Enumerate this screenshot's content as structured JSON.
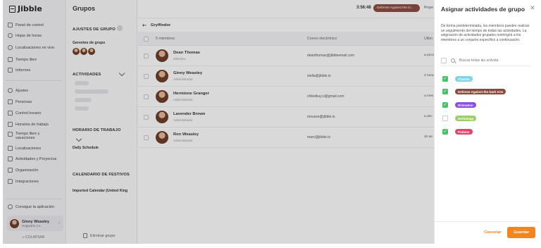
{
  "app": {
    "brand": "Jibble"
  },
  "sidebar": {
    "items": [
      {
        "label": "Panel de control",
        "icon": "dashboard-icon"
      },
      {
        "label": "Hojas de horas",
        "icon": "clock-icon"
      },
      {
        "label": "Localizaciones en vivo",
        "icon": "location-icon"
      },
      {
        "label": "Tiempo libre",
        "icon": "calendar-icon"
      },
      {
        "label": "Informes",
        "icon": "chart-icon"
      },
      {
        "label": "Ajustes",
        "icon": "settings-icon"
      },
      {
        "label": "Personas",
        "icon": "people-icon"
      },
      {
        "label": "Control horario",
        "icon": "timer-icon"
      },
      {
        "label": "Horarios de trabajo",
        "icon": "schedule-icon"
      },
      {
        "label": "Tiempo libre y vacaciones",
        "icon": "vacation-icon"
      },
      {
        "label": "Localizaciones",
        "icon": "pin-icon"
      },
      {
        "label": "Actividades y Proyectos",
        "icon": "projects-icon"
      },
      {
        "label": "Organización",
        "icon": "organization-icon"
      },
      {
        "label": "Integraciones",
        "icon": "integrations-icon"
      }
    ],
    "get_app": "Consigue la aplicación",
    "user": {
      "name": "Ginny Weasley",
      "org": "Hogwarts Co."
    },
    "collapse": "« COLAPSAR"
  },
  "group": {
    "page_title": "Grupos",
    "settings_title": "AJUSTES DE GRUPO",
    "managers_label": "Gerentes de grupo",
    "activities_title": "ACTIVIDADES",
    "schedule_title": "HORARIO DE TRABAJO",
    "schedule_value": "Daily Schedule",
    "holidays_title": "CALENDARIO DE FESTIVOS",
    "holidays_value": "Imported Calendar (United King",
    "delete": "Eliminar grupo"
  },
  "topbar": {
    "timer": "3:56:48",
    "current_activity": "Defense Against the D...",
    "project_clip": "Proye"
  },
  "members": {
    "back_label": "Gryffindor",
    "columns": [
      "5 miembros",
      "Correo electrónico",
      "Ultim"
    ],
    "rows": [
      {
        "name": "Dean Thomas",
        "role": "Miembro",
        "email": "deanthomas@jibbleemail.com",
        "last": "a pocos"
      },
      {
        "name": "Ginny Weasley",
        "role": "Administrador",
        "email": "stella@jibble.io",
        "last": "4 horas"
      },
      {
        "name": "Hermione Granger",
        "role": "Administrador",
        "email": "chiketkuy.o@gmail.com",
        "last": "a mes"
      },
      {
        "name": "Lavender Brown",
        "role": "Administrador",
        "email": "mousse@jibble.io",
        "last": "a dec"
      },
      {
        "name": "Ron Weasley",
        "role": "Administrador",
        "email": "marc@jibble.io",
        "last": "10 de"
      }
    ]
  },
  "drawer": {
    "title": "Asignar actividades de grupo",
    "description": "De forma predeterminada, los miembros pueden realizar un seguimiento del tiempo de todas las actividades. La asignación de actividades grupales restringirá a los miembros a un conjunto específico a continuación.",
    "search_placeholder": "Buscar todas las activida",
    "activities": [
      {
        "label": "Charms",
        "checked": true,
        "color": "#7fd3e6"
      },
      {
        "label": "Defense Against the Dark Arts",
        "checked": true,
        "color": "#8b4a3d"
      },
      {
        "label": "Divination",
        "checked": true,
        "color": "#8a4fe0"
      },
      {
        "label": "Herbology",
        "checked": false,
        "color": "#9bcf63"
      },
      {
        "label": "Potions",
        "checked": true,
        "color": "#e0466b"
      }
    ],
    "cancel": "Cancelar",
    "save": "Guardar"
  },
  "colors": {
    "accent": "#f2851f",
    "check": "#49c26e"
  }
}
